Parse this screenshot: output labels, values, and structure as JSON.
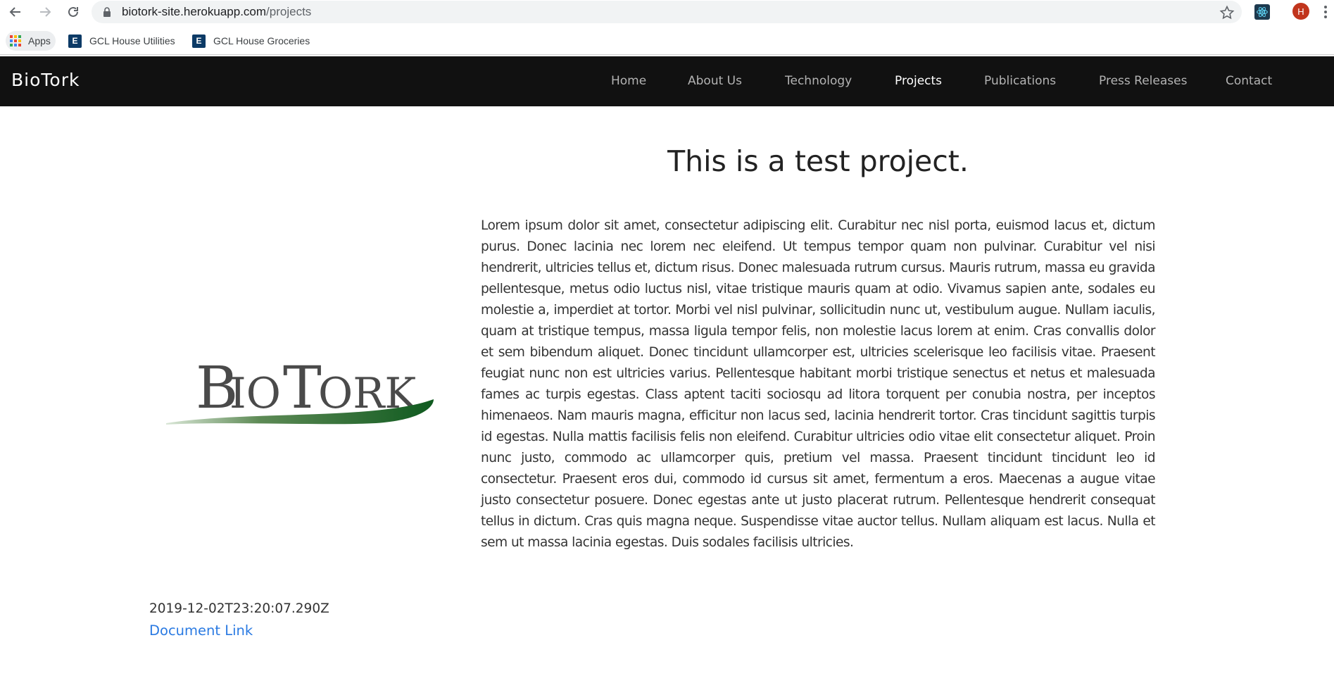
{
  "browser": {
    "url_host": "biotork-site.herokuapp.com",
    "url_path": "/projects",
    "profile_initial": "H",
    "bookmarks": [
      {
        "label": "Apps",
        "icon": "apps-grid-icon"
      },
      {
        "label": "GCL House Utilities",
        "icon": "e-icon"
      },
      {
        "label": "GCL House Groceries",
        "icon": "e-icon"
      }
    ]
  },
  "site": {
    "brand": "BioTork",
    "nav": [
      {
        "label": "Home",
        "active": false
      },
      {
        "label": "About Us",
        "active": false
      },
      {
        "label": "Technology",
        "active": false
      },
      {
        "label": "Projects",
        "active": true
      },
      {
        "label": "Publications",
        "active": false
      },
      {
        "label": "Press Releases",
        "active": false
      },
      {
        "label": "Contact",
        "active": false
      }
    ]
  },
  "project": {
    "logo_text": "BIOTORK",
    "title": "This is a test project.",
    "description": "Lorem ipsum dolor sit amet, consectetur adipiscing elit. Curabitur nec nisl porta, euismod lacus et, dictum purus. Donec lacinia nec lorem nec eleifend. Ut tempus tempor quam non pulvinar. Curabitur vel nisi hendrerit, ultricies tellus et, dictum risus. Donec malesuada rutrum cursus. Mauris rutrum, massa eu gravida pellentesque, metus odio luctus nisl, vitae tristique mauris quam at odio. Vivamus sapien ante, sodales eu molestie a, imperdiet at tortor. Morbi vel nisl pulvinar, sollicitudin nunc ut, vestibulum augue. Nullam iaculis, quam at tristique tempus, massa ligula tempor felis, non molestie lacus lorem at enim. Cras convallis dolor et sem bibendum aliquet. Donec tincidunt ullamcorper est, ultricies scelerisque leo facilisis vitae. Praesent feugiat nunc non est ultricies varius. Pellentesque habitant morbi tristique senectus et netus et malesuada fames ac turpis egestas. Class aptent taciti sociosqu ad litora torquent per conubia nostra, per inceptos himenaeos. Nam mauris magna, efficitur non lacus sed, lacinia hendrerit tortor. Cras tincidunt sagittis turpis id egestas. Nulla mattis facilisis felis non eleifend. Curabitur ultricies odio vitae elit consectetur aliquet. Proin nunc justo, commodo ac ullamcorper quis, pretium vel massa. Praesent tincidunt tincidunt leo id consectetur. Praesent eros dui, commodo id cursus sit amet, fermentum a eros. Maecenas a augue vitae justo consectetur posuere. Donec egestas ante ut justo placerat rutrum. Pellentesque hendrerit consequat tellus in dictum. Cras quis magna neque. Suspendisse vitae auctor tellus. Nullam aliquam est lacus. Nulla et sem ut massa lacinia egestas. Duis sodales facilisis ultricies.",
    "timestamp": "2019-12-02T23:20:07.290Z",
    "document_link": "Document Link"
  },
  "colors": {
    "nav_bg": "#111111",
    "nav_active": "#ffffff",
    "nav_inactive": "#b3b3b3",
    "link": "#2a7ae2",
    "logo_green": "#1f6b2c",
    "logo_gray": "#4a4a4a"
  }
}
